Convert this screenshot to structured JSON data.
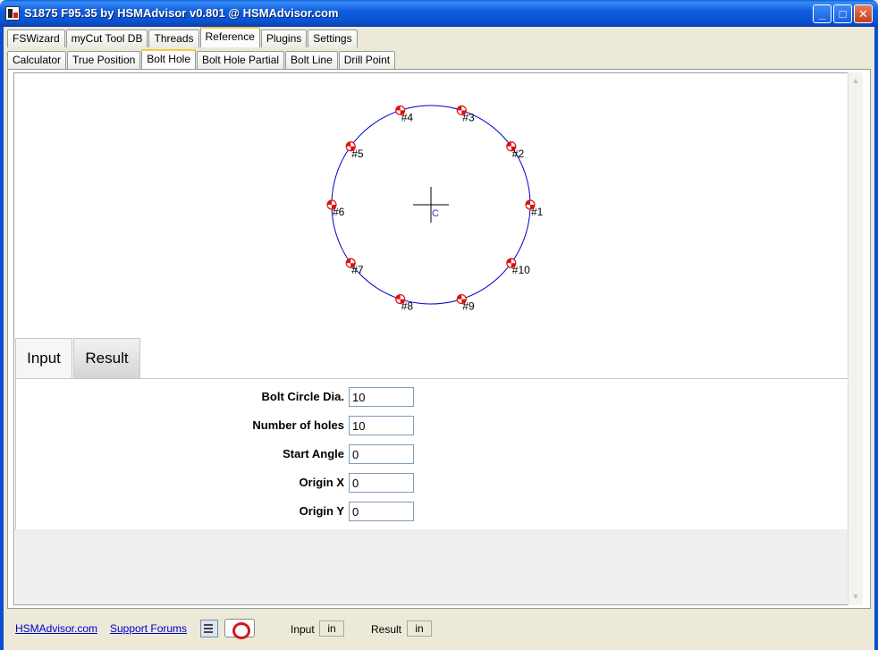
{
  "window": {
    "title": "S1875 F95.35 by HSMAdvisor v0.801 @ HSMAdvisor.com",
    "minimize_glyph": "_",
    "maximize_glyph": "□",
    "close_glyph": "✕"
  },
  "main_tabs": [
    {
      "label": "FSWizard"
    },
    {
      "label": "myCut Tool DB"
    },
    {
      "label": "Threads"
    },
    {
      "label": "Reference",
      "active": true
    },
    {
      "label": "Plugins"
    },
    {
      "label": "Settings"
    }
  ],
  "sub_tabs": [
    {
      "label": "Calculator"
    },
    {
      "label": "True Position"
    },
    {
      "label": "Bolt Hole",
      "active": true
    },
    {
      "label": "Bolt Hole Partial"
    },
    {
      "label": "Bolt Line"
    },
    {
      "label": "Drill Point"
    }
  ],
  "drawing": {
    "center_label": "C",
    "circle_color": "#0000cc",
    "hole_color": "#e01010",
    "holes": [
      {
        "label": "#1",
        "angle_deg": 0
      },
      {
        "label": "#2",
        "angle_deg": 36
      },
      {
        "label": "#3",
        "angle_deg": 72
      },
      {
        "label": "#4",
        "angle_deg": 108
      },
      {
        "label": "#5",
        "angle_deg": 144
      },
      {
        "label": "#6",
        "angle_deg": 180
      },
      {
        "label": "#7",
        "angle_deg": 216
      },
      {
        "label": "#8",
        "angle_deg": 252
      },
      {
        "label": "#9",
        "angle_deg": 288
      },
      {
        "label": "#10",
        "angle_deg": 324
      }
    ]
  },
  "io_tabs": {
    "input": "Input",
    "result": "Result"
  },
  "form": {
    "fields": [
      {
        "label": "Bolt Circle Dia.",
        "value": "10"
      },
      {
        "label": "Number of holes",
        "value": "10"
      },
      {
        "label": "Start Angle",
        "value": "0"
      },
      {
        "label": "Origin X",
        "value": "0"
      },
      {
        "label": "Origin Y",
        "value": "0"
      }
    ]
  },
  "status": {
    "link_site": "HSMAdvisor.com",
    "link_forums": "Support Forums",
    "input_label": "Input",
    "input_unit": "in",
    "result_label": "Result",
    "result_unit": "in"
  }
}
